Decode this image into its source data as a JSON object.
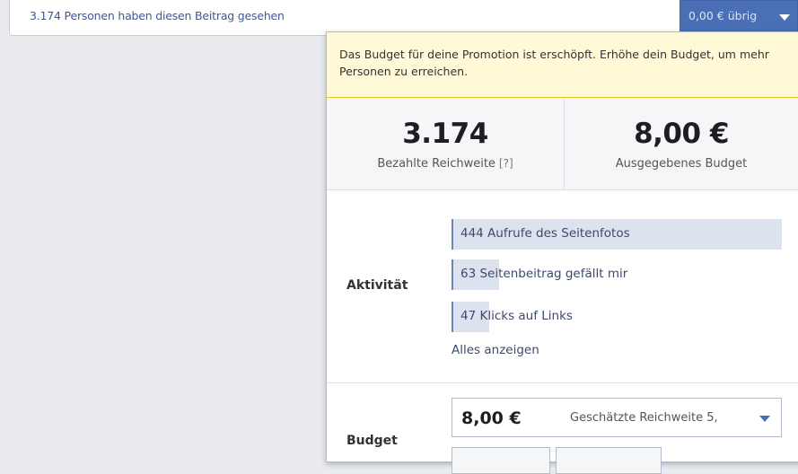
{
  "header": {
    "seen_text": "3.174 Personen haben diesen Beitrag gesehen",
    "remaining_label": "0,00 € übrig"
  },
  "notice": {
    "text": "Das Budget für deine Promotion ist erschöpft. Erhöhe dein Budget, um mehr Personen zu erreichen."
  },
  "stats": {
    "reach": {
      "value": "3.174",
      "label": "Bezahlte Reichweite",
      "help": "[?]"
    },
    "spent": {
      "value": "8,00 €",
      "label": "Ausgegebenes Budget"
    }
  },
  "activity": {
    "label": "Aktivität",
    "items": [
      {
        "text": "444 Aufrufe des Seitenfotos",
        "fraction": 1.0
      },
      {
        "text": "63 Seitenbeitrag gefällt mir",
        "fraction": 0.14
      },
      {
        "text": "47 Klicks auf Links",
        "fraction": 0.11
      }
    ],
    "show_all": "Alles anzeigen"
  },
  "budget": {
    "label": "Budget",
    "amount": "8,00 €",
    "reach_text": "Geschätzte Reichweite 5,"
  },
  "colors": {
    "accent": "#4a6fb5",
    "link": "#3b5998",
    "notice_bg": "#fff9d7"
  }
}
